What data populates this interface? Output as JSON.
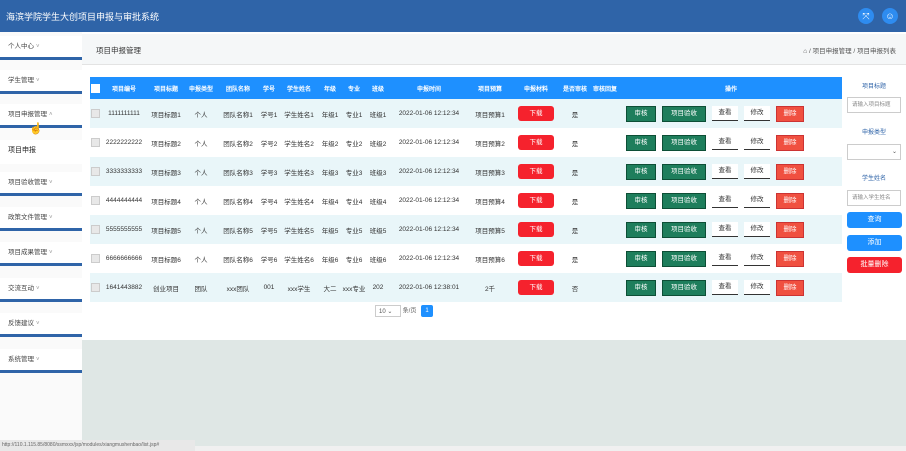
{
  "app": {
    "title": "海滨学院学生大创项目申报与审批系统"
  },
  "header_icons": [
    "expand-icon",
    "user-icon"
  ],
  "sidebar": {
    "items": [
      {
        "label": "个人中心",
        "has_caret": true
      },
      {
        "label": "学生管理",
        "has_caret": true
      },
      {
        "label": "项目申报管理",
        "has_caret": true
      },
      {
        "label": "项目申报",
        "has_caret": false,
        "active": true
      },
      {
        "label": "项目验收管理",
        "has_caret": true
      },
      {
        "label": "政策文件管理",
        "has_caret": true
      },
      {
        "label": "项目成果管理",
        "has_caret": true
      },
      {
        "label": "交流互动",
        "has_caret": true
      },
      {
        "label": "反馈建议",
        "has_caret": true
      },
      {
        "label": "系统管理",
        "has_caret": true
      }
    ]
  },
  "page": {
    "title": "项目申报管理",
    "breadcrumb": "项目申报管理 / 项目申报列表"
  },
  "table": {
    "headers": [
      "项目编号",
      "项目标题",
      "申报类型",
      "团队名称",
      "学号",
      "学生姓名",
      "年级",
      "专业",
      "班级",
      "申报时间",
      "项目预算",
      "申报材料",
      "是否审核",
      "审核回复",
      "操作"
    ],
    "rows": [
      [
        "1111111111",
        "项目标题1",
        "个人",
        "团队名称1",
        "学号1",
        "学生姓名1",
        "年级1",
        "专业1",
        "班级1",
        "2022-01-06 12:12:34",
        "项目预算1",
        "下载",
        "是",
        ""
      ],
      [
        "2222222222",
        "项目标题2",
        "个人",
        "团队名称2",
        "学号2",
        "学生姓名2",
        "年级2",
        "专业2",
        "班级2",
        "2022-01-06 12:12:34",
        "项目预算2",
        "下载",
        "是",
        ""
      ],
      [
        "3333333333",
        "项目标题3",
        "个人",
        "团队名称3",
        "学号3",
        "学生姓名3",
        "年级3",
        "专业3",
        "班级3",
        "2022-01-06 12:12:34",
        "项目预算3",
        "下载",
        "是",
        ""
      ],
      [
        "4444444444",
        "项目标题4",
        "个人",
        "团队名称4",
        "学号4",
        "学生姓名4",
        "年级4",
        "专业4",
        "班级4",
        "2022-01-06 12:12:34",
        "项目预算4",
        "下载",
        "是",
        ""
      ],
      [
        "5555555555",
        "项目标题5",
        "个人",
        "团队名称5",
        "学号5",
        "学生姓名5",
        "年级5",
        "专业5",
        "班级5",
        "2022-01-06 12:12:34",
        "项目预算5",
        "下载",
        "是",
        ""
      ],
      [
        "6666666666",
        "项目标题6",
        "个人",
        "团队名称6",
        "学号6",
        "学生姓名6",
        "年级6",
        "专业6",
        "班级6",
        "2022-01-06 12:12:34",
        "项目预算6",
        "下载",
        "是",
        ""
      ],
      [
        "1641443882",
        "创业项目",
        "团队",
        "xxx团队",
        "001",
        "xxx学生",
        "大二",
        "xxx专业",
        "202",
        "2022-01-06 12:38:01",
        "2千",
        "下载",
        "否",
        ""
      ]
    ],
    "actions": [
      "审核",
      "项目验收",
      "查看",
      "修改",
      "删除"
    ]
  },
  "pagination": {
    "page_size": "10",
    "per_page_label": "条/页",
    "current_page": "1"
  },
  "filters": {
    "project_title_label": "项目标题",
    "project_title_placeholder": "请输入项目标题",
    "declare_type_label": "申报类型",
    "declare_type_value": "",
    "student_name_label": "学生姓名",
    "student_name_placeholder": "请输入学生姓名",
    "search_button": "查询",
    "add_button": "添加",
    "batch_delete_button": "批量删除"
  },
  "status_bar": {
    "url": "http://110.1.115.85/8080/ssmxxx/jsp/modules/xiangmushenbao/list.jsp#"
  },
  "colors": {
    "topbar": "#2f64a8",
    "table_header": "#1e90ff",
    "row_alt": "#e9f6f9",
    "download_btn": "#f5222d",
    "action_green": "#1e7e5c",
    "delete_red": "#f05040",
    "search_btn": "#1e90ff",
    "batch_delete_btn": "#f5222d"
  }
}
